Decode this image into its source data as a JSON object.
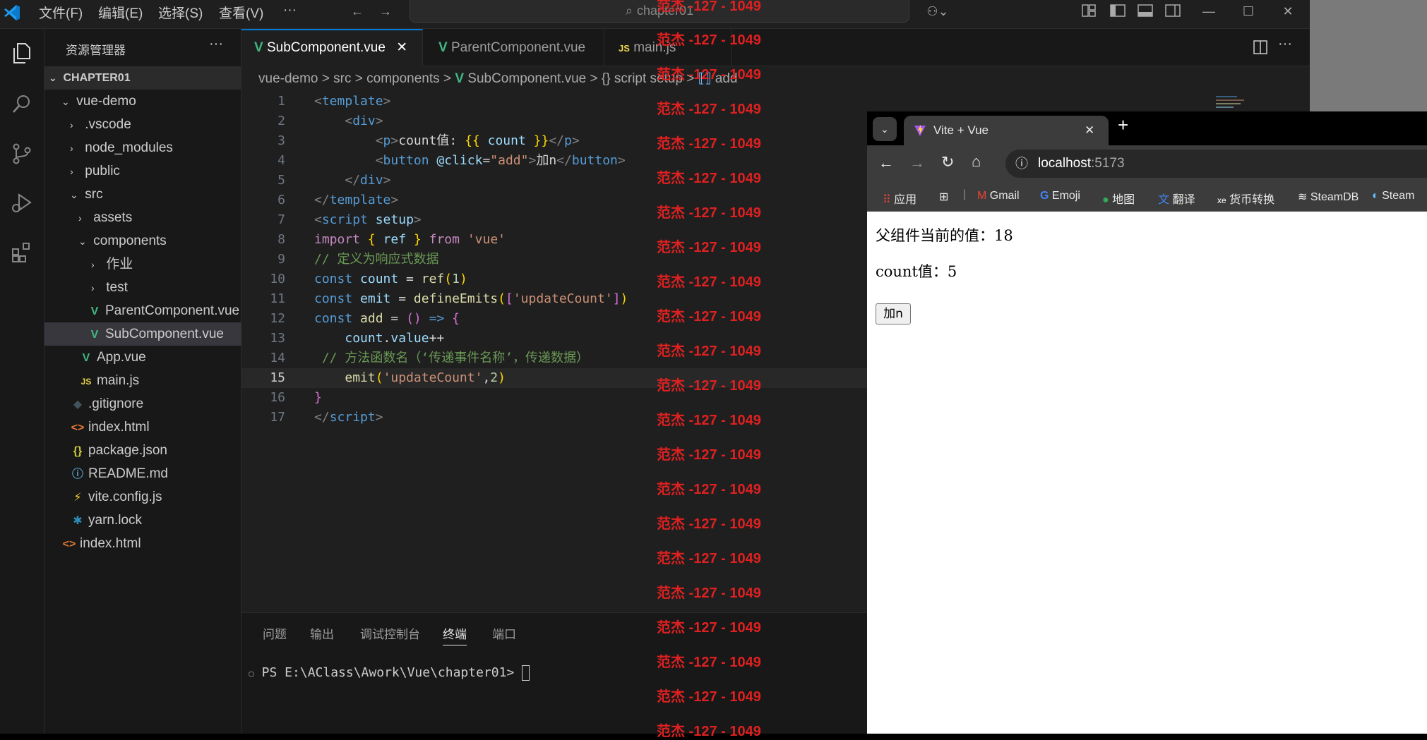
{
  "menu": {
    "file": "文件(F)",
    "edit": "编辑(E)",
    "select": "选择(S)",
    "view": "查看(V)",
    "more": "···"
  },
  "search": {
    "placeholder": "chapter01"
  },
  "sidebar": {
    "title": "资源管理器",
    "section": "CHAPTER01",
    "items": [
      {
        "label": "vue-demo"
      },
      {
        "label": ".vscode"
      },
      {
        "label": "node_modules"
      },
      {
        "label": "public"
      },
      {
        "label": "src"
      },
      {
        "label": "assets"
      },
      {
        "label": "components"
      },
      {
        "label": "作业"
      },
      {
        "label": "test"
      },
      {
        "label": "ParentComponent.vue"
      },
      {
        "label": "SubComponent.vue"
      },
      {
        "label": "App.vue"
      },
      {
        "label": "main.js"
      },
      {
        "label": ".gitignore"
      },
      {
        "label": "index.html"
      },
      {
        "label": "package.json"
      },
      {
        "label": "README.md"
      },
      {
        "label": "vite.config.js"
      },
      {
        "label": "yarn.lock"
      },
      {
        "label": "index.html"
      }
    ]
  },
  "tabs": [
    {
      "label": "SubComponent.vue"
    },
    {
      "label": "ParentComponent.vue"
    },
    {
      "label": "main.js"
    }
  ],
  "breadcrumb": {
    "a": "vue-demo",
    "b": "src",
    "c": "components",
    "d": "SubComponent.vue",
    "e": "{} script setup",
    "f": "add"
  },
  "code": {
    "numbers": [
      "1",
      "2",
      "3",
      "4",
      "5",
      "6",
      "7",
      "8",
      "9",
      "10",
      "11",
      "12",
      "13",
      "14",
      "15",
      "16",
      "17"
    ]
  },
  "panel": {
    "tabs": [
      "问题",
      "输出",
      "调试控制台",
      "终端",
      "端口"
    ],
    "prompt": "PS E:\\AClass\\Awork\\Vue\\chapter01> "
  },
  "watermark": "范杰 -127 - 1049",
  "browser": {
    "tab_title": "Vite + Vue",
    "url_host": "localhost",
    "url_port": ":5173",
    "bookmarks": [
      "应用",
      "Gmail",
      "Emoji",
      "地图",
      "翻译",
      "货币转换",
      "SteamDB",
      "Steam"
    ],
    "parent_text": "父组件当前的值：18",
    "count_text": "count值：5",
    "button": "加n"
  }
}
